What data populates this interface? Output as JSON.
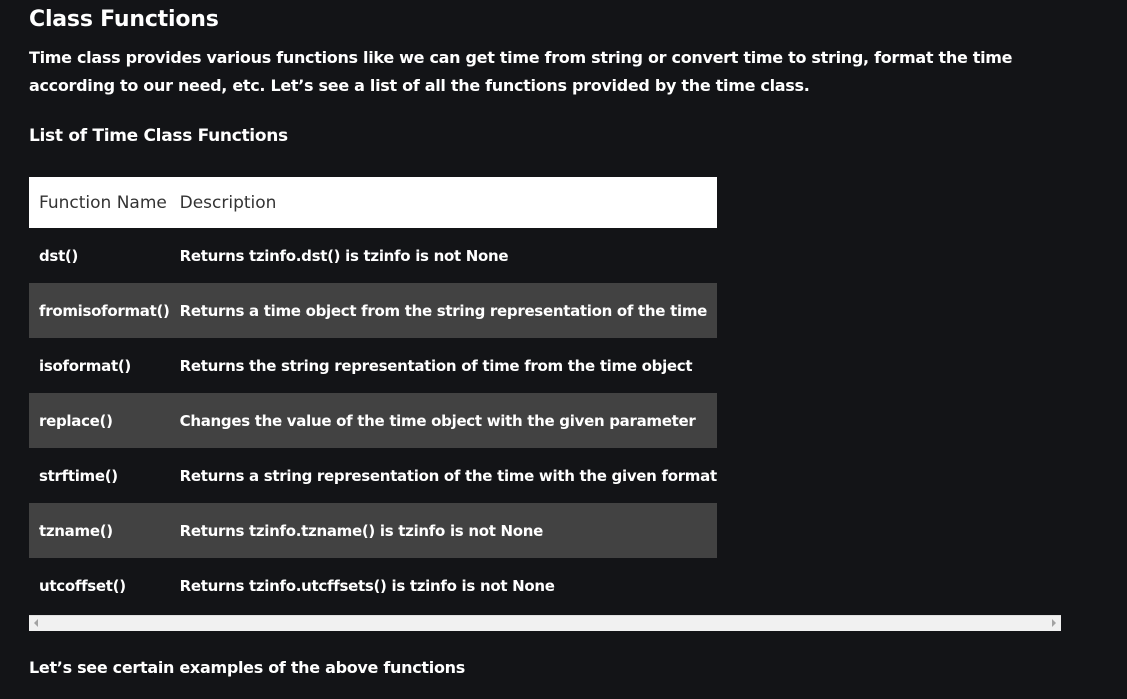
{
  "article": {
    "title": "Class Functions",
    "intro": "Time class provides various functions like we can get time from string or convert time to string, format the time according to our need, etc. Let’s see a list of all the functions provided by the time class.",
    "subtitle": "List of Time Class Functions",
    "outro": "Let’s see certain examples of the above functions"
  },
  "table": {
    "headers": [
      "Function Name",
      "Description"
    ],
    "rows": [
      {
        "name": "dst()",
        "description": "Returns tzinfo.dst() is tzinfo is not None"
      },
      {
        "name": "fromisoformat()",
        "description": "Returns a time object from the string representation of the time"
      },
      {
        "name": "isoformat()",
        "description": "Returns the string representation of time from the time object"
      },
      {
        "name": "replace()",
        "description": "Changes the value of the time object with the given parameter"
      },
      {
        "name": "strftime()",
        "description": "Returns a string representation of the time with the given format"
      },
      {
        "name": "tzname()",
        "description": "Returns tzinfo.tzname() is tzinfo is not None"
      },
      {
        "name": "utcoffset()",
        "description": "Returns tzinfo.utcffsets() is tzinfo is not None"
      }
    ]
  },
  "scrollbar": {
    "left_icon": "chevron-left-icon",
    "right_icon": "chevron-right-icon"
  },
  "colors": {
    "background": "#131417",
    "row_alt": "#424242",
    "header_bg": "#ffffff",
    "header_text": "#333333",
    "text": "#ffffff"
  }
}
